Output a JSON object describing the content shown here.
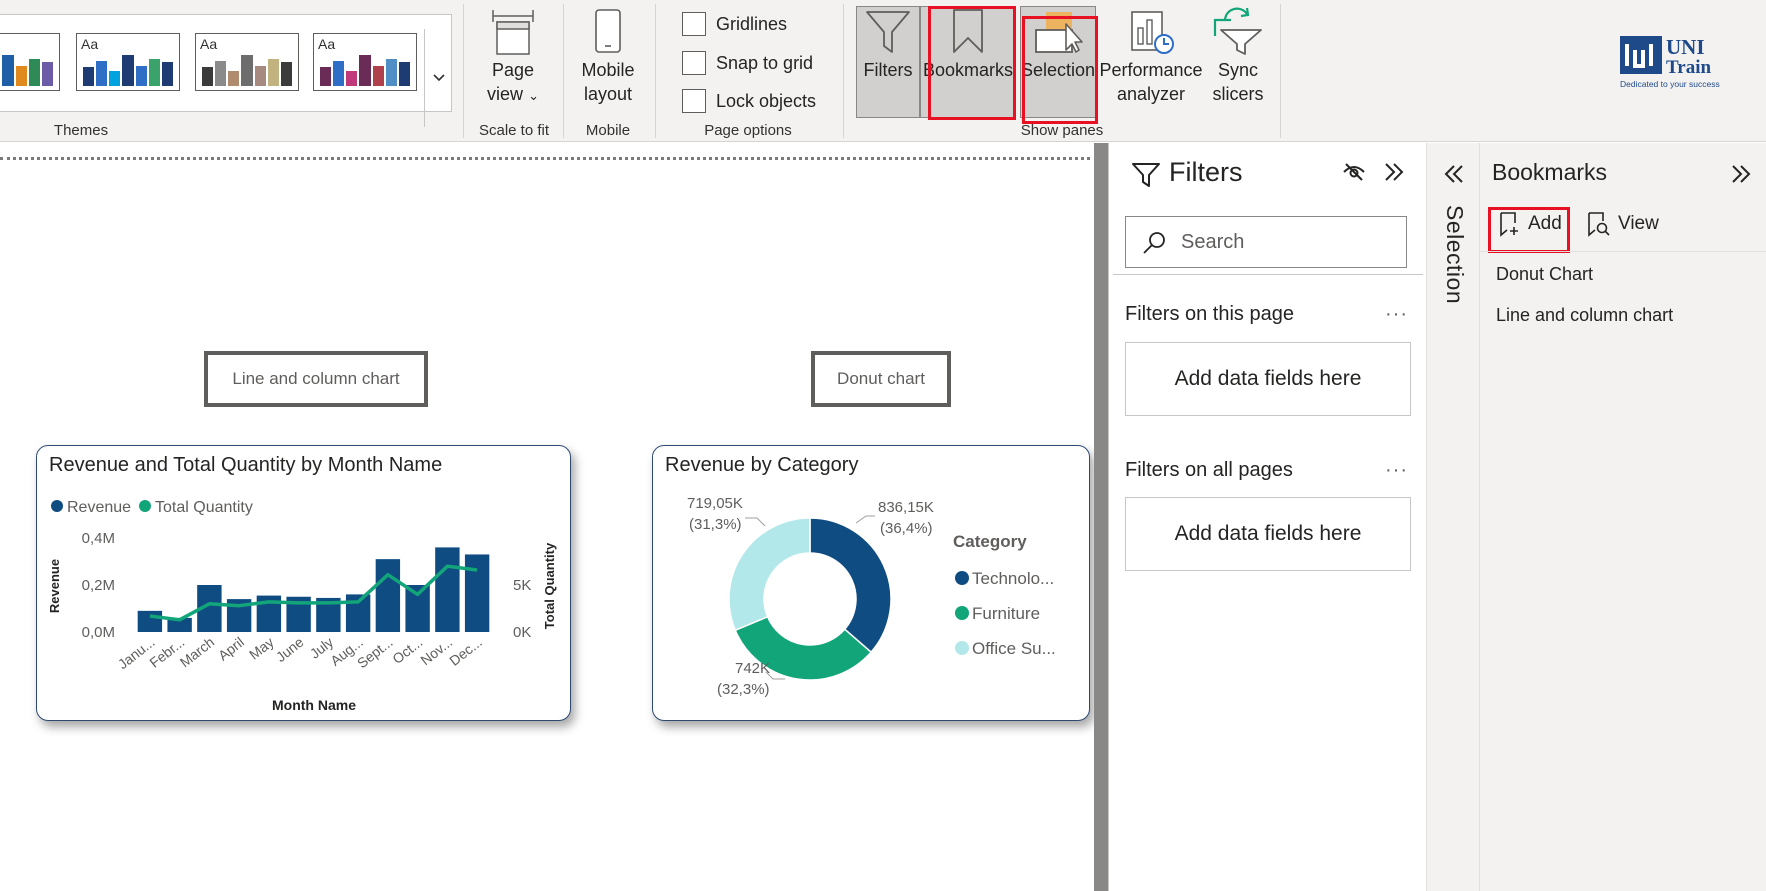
{
  "ribbon": {
    "groups": {
      "themes": "Themes",
      "scale_to_fit": "Scale to fit",
      "mobile": "Mobile",
      "page_options": "Page options",
      "show_panes": "Show panes"
    },
    "theme_thumbs": [
      {
        "label": "",
        "colors": [
          "#1e3a6e",
          "#e5553a",
          "#7e2a9b",
          "#1f5fa8",
          "#e08a1e",
          "#2e8b57",
          "#6c5ba7"
        ]
      },
      {
        "label": "Aa",
        "colors": [
          "#1f3b73",
          "#2f6ec7",
          "#00a3e0",
          "#1f3b73",
          "#2f6ec7",
          "#39a36b",
          "#1f3b73"
        ]
      },
      {
        "label": "Aa",
        "colors": [
          "#3b3b3b",
          "#8a8a8a",
          "#b08b6e",
          "#6d6d6d",
          "#a78a7f",
          "#c2b280",
          "#3b3b3b"
        ]
      },
      {
        "label": "Aa",
        "colors": [
          "#6b2b57",
          "#2f6ec7",
          "#c0397a",
          "#6b2b57",
          "#b0414c",
          "#4f8fc6",
          "#1f3b73"
        ]
      }
    ],
    "page_view": {
      "line1": "Page",
      "line2": "view"
    },
    "mobile_layout": {
      "line1": "Mobile",
      "line2": "layout"
    },
    "page_options": {
      "gridlines": "Gridlines",
      "snap_to_grid": "Snap to grid",
      "lock_objects": "Lock objects"
    },
    "panes": {
      "filters": "Filters",
      "bookmarks": "Bookmarks",
      "selection": "Selection",
      "performance": {
        "line1": "Performance",
        "line2": "analyzer"
      },
      "sync": {
        "line1": "Sync",
        "line2": "slicers"
      }
    },
    "logo": {
      "brand": "UNI Train",
      "tagline": "Dedicated to your success"
    }
  },
  "canvas": {
    "bookmark_buttons": {
      "line_column": "Line and column chart",
      "donut": "Donut chart"
    }
  },
  "colors": {
    "navy": "#0f4c81",
    "green": "#12a57a",
    "light_teal": "#b3e8ea",
    "highlight_red": "#e81123",
    "pane_bg": "#f3f2f1"
  },
  "chart_data": [
    {
      "type": "bar",
      "title": "Revenue and Total Quantity by Month Name",
      "legend": [
        "Revenue",
        "Total Quantity"
      ],
      "legend_position": "top-left",
      "xlabel": "Month Name",
      "ylabel": "Revenue",
      "y2label": "Total Quantity",
      "categories": [
        "Janu...",
        "Febr...",
        "March",
        "April",
        "May",
        "June",
        "July",
        "Aug...",
        "Sept...",
        "Oct...",
        "Nov...",
        "Dec..."
      ],
      "series": [
        {
          "name": "Revenue",
          "kind": "column",
          "axis": "left",
          "values": [
            0.09,
            0.06,
            0.2,
            0.14,
            0.155,
            0.15,
            0.145,
            0.16,
            0.31,
            0.2,
            0.36,
            0.33
          ]
        },
        {
          "name": "Total Quantity",
          "kind": "line",
          "axis": "right",
          "values": [
            1.7,
            1.3,
            3.0,
            2.8,
            3.2,
            3.1,
            3.1,
            3.2,
            6.1,
            4.0,
            7.0,
            6.6
          ]
        }
      ],
      "ylim": [
        0,
        0.4
      ],
      "yticks": [
        "0,0M",
        "0,2M",
        "0,4M"
      ],
      "y2lim": [
        0,
        10
      ],
      "y2ticks": [
        "0K",
        "5K"
      ]
    },
    {
      "type": "pie",
      "donut": true,
      "title": "Revenue by Category",
      "legend_title": "Category",
      "legend_position": "right",
      "categories": [
        "Technolo...",
        "Furniture",
        "Office Su..."
      ],
      "values": [
        836.15,
        742,
        719.05
      ],
      "data_labels": [
        {
          "value": "836,15K",
          "percent": "(36,4%)"
        },
        {
          "value": "742K",
          "percent": "(32,3%)"
        },
        {
          "value": "719,05K",
          "percent": "(31,3%)"
        }
      ],
      "slice_fractions": [
        0.364,
        0.323,
        0.313
      ]
    }
  ],
  "filters_pane": {
    "title": "Filters",
    "search_placeholder": "Search",
    "on_this_page": "Filters on this page",
    "on_all_pages": "Filters on all pages",
    "add_fields": "Add data fields here",
    "more": "···"
  },
  "selection_pane": {
    "title": "Selection"
  },
  "bookmarks_pane": {
    "title": "Bookmarks",
    "add": "Add",
    "view": "View",
    "items": [
      "Donut Chart",
      "Line and column chart"
    ]
  }
}
